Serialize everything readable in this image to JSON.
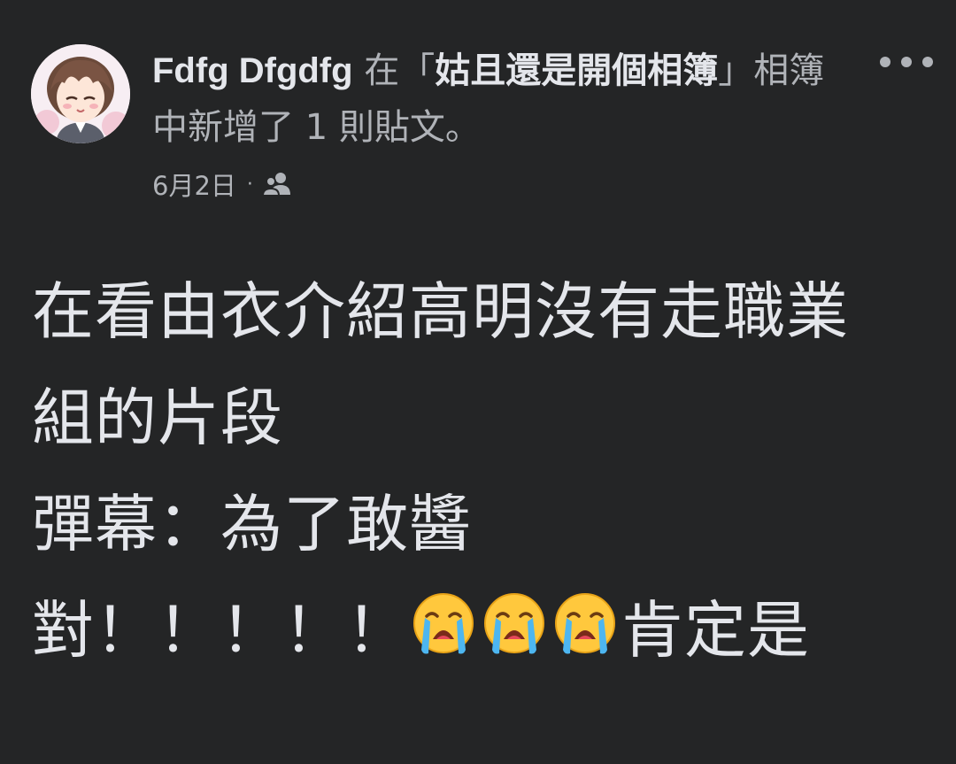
{
  "post": {
    "author": "Fdfg Dfgdfg",
    "header_in": "在",
    "album_open_bracket": "「",
    "album_name": "姑且還是開個相簿",
    "album_close_bracket": "」",
    "header_rest": "相簿中新增了 1 則貼文。",
    "date": "6月2日",
    "separator": "·",
    "audience_icon": "friends-icon",
    "more_icon": "more-horizontal-icon",
    "body": {
      "line1": "在看由衣介紹高明沒有走職業",
      "line2": "組的片段",
      "line3": "彈幕：為了敢醬",
      "line4_prefix": "對！！！！！",
      "line4_emoji": "loudly-crying-face",
      "line4_suffix": "肯定是"
    }
  },
  "colors": {
    "background": "#242526",
    "primary_text": "#e4e6eb",
    "secondary_text": "#b0b3b8"
  }
}
